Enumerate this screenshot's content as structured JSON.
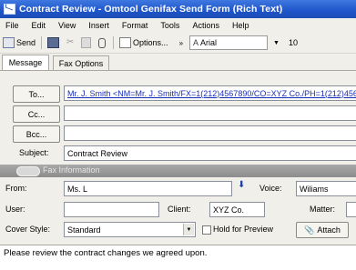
{
  "window": {
    "title": "Contract Review - Omtool Genifax Send Form (Rich Text)"
  },
  "menu": [
    "File",
    "Edit",
    "View",
    "Insert",
    "Format",
    "Tools",
    "Actions",
    "Help"
  ],
  "toolbar": {
    "send": "Send",
    "options": "Options...",
    "font": "Arial",
    "size": "10"
  },
  "tabs": [
    "Message",
    "Fax Options"
  ],
  "recipients": {
    "to_label": "To...",
    "to_value": "Mr. J. Smith <NM=Mr. J. Smith/FX=1(212)4567890/CO=XYZ Co./PH=1(212)456",
    "cc_label": "Cc...",
    "cc_value": "",
    "bcc_label": "Bcc...",
    "bcc_value": ""
  },
  "subject": {
    "label": "Subject:",
    "value": "Contract Review"
  },
  "fax_info": {
    "label": "Fax Information"
  },
  "fax": {
    "from_label": "From:",
    "from_value": "Ms. L",
    "voice_label": "Voice:",
    "voice_value": "Wiliams",
    "user_label": "User:",
    "user_value": "",
    "client_label": "Client:",
    "client_value": "XYZ Co.",
    "matter_label": "Matter:",
    "matter_value": "",
    "cover_label": "Cover Style:",
    "cover_value": "Standard",
    "hold_label": "Hold for Preview",
    "attach_label": "Attach"
  },
  "message_body": "Please review the contract changes we agreed upon."
}
